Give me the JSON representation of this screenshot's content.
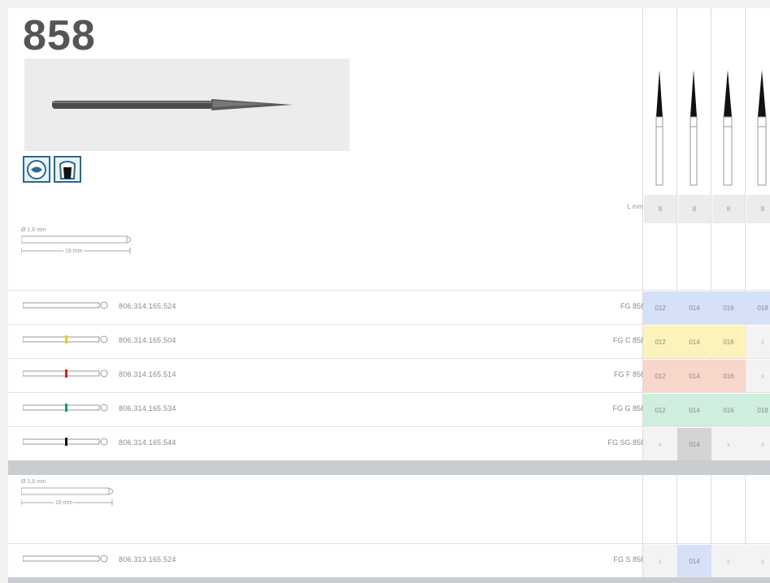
{
  "title": "858",
  "industry_icons": [
    "dental-lab-icon",
    "dental-tooth-icon"
  ],
  "column_header": {
    "lmm_label": "L mm",
    "lmm_values": [
      "8",
      "8",
      "8",
      "8"
    ]
  },
  "section1": {
    "dim_diameter": "Ø 1,6 mm",
    "dim_length": "19 mm",
    "rows": [
      {
        "ref": "806.314.165.524",
        "code": "FG 858",
        "band": "none",
        "cells": [
          "012",
          "014",
          "016",
          "018"
        ],
        "color": "#d6e0f7"
      },
      {
        "ref": "806.314.165.504",
        "code": "FG C 858",
        "band": "yellow",
        "cells": [
          "012",
          "014",
          "016",
          "x"
        ],
        "color": "#fbf3b9"
      },
      {
        "ref": "806.314.165.514",
        "code": "FG F 858",
        "band": "red",
        "cells": [
          "012",
          "014",
          "016",
          "x"
        ],
        "color": "#f8d6c9"
      },
      {
        "ref": "806.314.165.534",
        "code": "FG G 858",
        "band": "green",
        "cells": [
          "012",
          "014",
          "016",
          "018"
        ],
        "color": "#cfeedd"
      },
      {
        "ref": "806.314.165.544",
        "code": "FG SG 858",
        "band": "black",
        "cells": [
          "x",
          "014",
          "x",
          "x"
        ],
        "color": "#d4d4d4"
      }
    ]
  },
  "section2": {
    "dim_diameter": "Ø 1,6 mm",
    "dim_length": "16 mm",
    "rows": [
      {
        "ref": "806.313.165.524",
        "code": "FG S 858",
        "band": "none",
        "cells": [
          "x",
          "014",
          "x",
          "x"
        ],
        "color": "#d6e0f7"
      }
    ]
  }
}
